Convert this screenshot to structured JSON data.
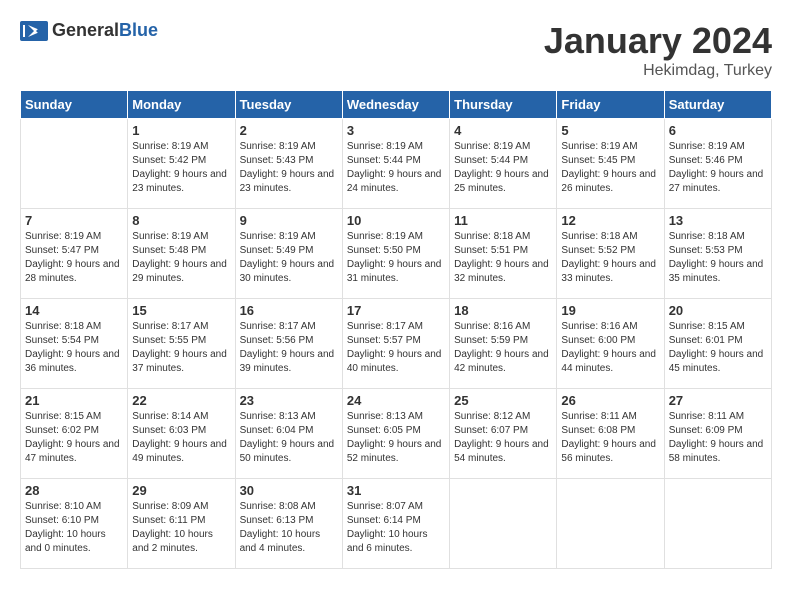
{
  "header": {
    "logo_general": "General",
    "logo_blue": "Blue",
    "month": "January 2024",
    "location": "Hekimdag, Turkey"
  },
  "weekdays": [
    "Sunday",
    "Monday",
    "Tuesday",
    "Wednesday",
    "Thursday",
    "Friday",
    "Saturday"
  ],
  "weeks": [
    [
      {
        "day": "",
        "sunrise": "",
        "sunset": "",
        "daylight": ""
      },
      {
        "day": "1",
        "sunrise": "Sunrise: 8:19 AM",
        "sunset": "Sunset: 5:42 PM",
        "daylight": "Daylight: 9 hours and 23 minutes."
      },
      {
        "day": "2",
        "sunrise": "Sunrise: 8:19 AM",
        "sunset": "Sunset: 5:43 PM",
        "daylight": "Daylight: 9 hours and 23 minutes."
      },
      {
        "day": "3",
        "sunrise": "Sunrise: 8:19 AM",
        "sunset": "Sunset: 5:44 PM",
        "daylight": "Daylight: 9 hours and 24 minutes."
      },
      {
        "day": "4",
        "sunrise": "Sunrise: 8:19 AM",
        "sunset": "Sunset: 5:44 PM",
        "daylight": "Daylight: 9 hours and 25 minutes."
      },
      {
        "day": "5",
        "sunrise": "Sunrise: 8:19 AM",
        "sunset": "Sunset: 5:45 PM",
        "daylight": "Daylight: 9 hours and 26 minutes."
      },
      {
        "day": "6",
        "sunrise": "Sunrise: 8:19 AM",
        "sunset": "Sunset: 5:46 PM",
        "daylight": "Daylight: 9 hours and 27 minutes."
      }
    ],
    [
      {
        "day": "7",
        "sunrise": "Sunrise: 8:19 AM",
        "sunset": "Sunset: 5:47 PM",
        "daylight": "Daylight: 9 hours and 28 minutes."
      },
      {
        "day": "8",
        "sunrise": "Sunrise: 8:19 AM",
        "sunset": "Sunset: 5:48 PM",
        "daylight": "Daylight: 9 hours and 29 minutes."
      },
      {
        "day": "9",
        "sunrise": "Sunrise: 8:19 AM",
        "sunset": "Sunset: 5:49 PM",
        "daylight": "Daylight: 9 hours and 30 minutes."
      },
      {
        "day": "10",
        "sunrise": "Sunrise: 8:19 AM",
        "sunset": "Sunset: 5:50 PM",
        "daylight": "Daylight: 9 hours and 31 minutes."
      },
      {
        "day": "11",
        "sunrise": "Sunrise: 8:18 AM",
        "sunset": "Sunset: 5:51 PM",
        "daylight": "Daylight: 9 hours and 32 minutes."
      },
      {
        "day": "12",
        "sunrise": "Sunrise: 8:18 AM",
        "sunset": "Sunset: 5:52 PM",
        "daylight": "Daylight: 9 hours and 33 minutes."
      },
      {
        "day": "13",
        "sunrise": "Sunrise: 8:18 AM",
        "sunset": "Sunset: 5:53 PM",
        "daylight": "Daylight: 9 hours and 35 minutes."
      }
    ],
    [
      {
        "day": "14",
        "sunrise": "Sunrise: 8:18 AM",
        "sunset": "Sunset: 5:54 PM",
        "daylight": "Daylight: 9 hours and 36 minutes."
      },
      {
        "day": "15",
        "sunrise": "Sunrise: 8:17 AM",
        "sunset": "Sunset: 5:55 PM",
        "daylight": "Daylight: 9 hours and 37 minutes."
      },
      {
        "day": "16",
        "sunrise": "Sunrise: 8:17 AM",
        "sunset": "Sunset: 5:56 PM",
        "daylight": "Daylight: 9 hours and 39 minutes."
      },
      {
        "day": "17",
        "sunrise": "Sunrise: 8:17 AM",
        "sunset": "Sunset: 5:57 PM",
        "daylight": "Daylight: 9 hours and 40 minutes."
      },
      {
        "day": "18",
        "sunrise": "Sunrise: 8:16 AM",
        "sunset": "Sunset: 5:59 PM",
        "daylight": "Daylight: 9 hours and 42 minutes."
      },
      {
        "day": "19",
        "sunrise": "Sunrise: 8:16 AM",
        "sunset": "Sunset: 6:00 PM",
        "daylight": "Daylight: 9 hours and 44 minutes."
      },
      {
        "day": "20",
        "sunrise": "Sunrise: 8:15 AM",
        "sunset": "Sunset: 6:01 PM",
        "daylight": "Daylight: 9 hours and 45 minutes."
      }
    ],
    [
      {
        "day": "21",
        "sunrise": "Sunrise: 8:15 AM",
        "sunset": "Sunset: 6:02 PM",
        "daylight": "Daylight: 9 hours and 47 minutes."
      },
      {
        "day": "22",
        "sunrise": "Sunrise: 8:14 AM",
        "sunset": "Sunset: 6:03 PM",
        "daylight": "Daylight: 9 hours and 49 minutes."
      },
      {
        "day": "23",
        "sunrise": "Sunrise: 8:13 AM",
        "sunset": "Sunset: 6:04 PM",
        "daylight": "Daylight: 9 hours and 50 minutes."
      },
      {
        "day": "24",
        "sunrise": "Sunrise: 8:13 AM",
        "sunset": "Sunset: 6:05 PM",
        "daylight": "Daylight: 9 hours and 52 minutes."
      },
      {
        "day": "25",
        "sunrise": "Sunrise: 8:12 AM",
        "sunset": "Sunset: 6:07 PM",
        "daylight": "Daylight: 9 hours and 54 minutes."
      },
      {
        "day": "26",
        "sunrise": "Sunrise: 8:11 AM",
        "sunset": "Sunset: 6:08 PM",
        "daylight": "Daylight: 9 hours and 56 minutes."
      },
      {
        "day": "27",
        "sunrise": "Sunrise: 8:11 AM",
        "sunset": "Sunset: 6:09 PM",
        "daylight": "Daylight: 9 hours and 58 minutes."
      }
    ],
    [
      {
        "day": "28",
        "sunrise": "Sunrise: 8:10 AM",
        "sunset": "Sunset: 6:10 PM",
        "daylight": "Daylight: 10 hours and 0 minutes."
      },
      {
        "day": "29",
        "sunrise": "Sunrise: 8:09 AM",
        "sunset": "Sunset: 6:11 PM",
        "daylight": "Daylight: 10 hours and 2 minutes."
      },
      {
        "day": "30",
        "sunrise": "Sunrise: 8:08 AM",
        "sunset": "Sunset: 6:13 PM",
        "daylight": "Daylight: 10 hours and 4 minutes."
      },
      {
        "day": "31",
        "sunrise": "Sunrise: 8:07 AM",
        "sunset": "Sunset: 6:14 PM",
        "daylight": "Daylight: 10 hours and 6 minutes."
      },
      {
        "day": "",
        "sunrise": "",
        "sunset": "",
        "daylight": ""
      },
      {
        "day": "",
        "sunrise": "",
        "sunset": "",
        "daylight": ""
      },
      {
        "day": "",
        "sunrise": "",
        "sunset": "",
        "daylight": ""
      }
    ]
  ]
}
